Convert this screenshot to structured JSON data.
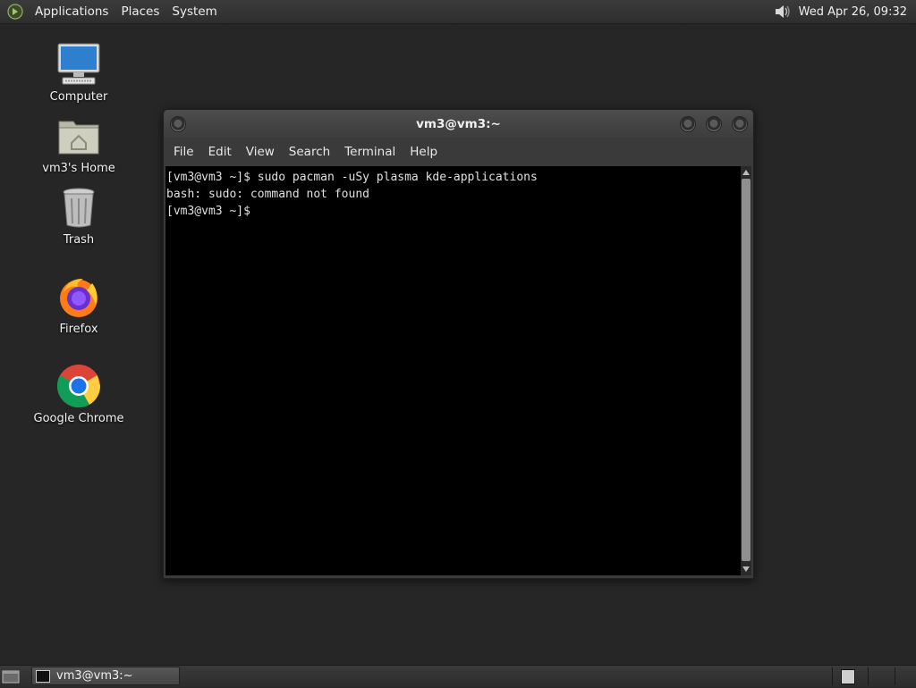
{
  "top_panel": {
    "menus": [
      "Applications",
      "Places",
      "System"
    ],
    "clock": "Wed Apr 26, 09:32"
  },
  "desktop": {
    "icons": [
      {
        "label": "Computer",
        "icon": "computer-icon"
      },
      {
        "label": "vm3's Home",
        "icon": "home-folder-icon"
      },
      {
        "label": "Trash",
        "icon": "trash-icon"
      },
      {
        "label": "Firefox",
        "icon": "firefox-icon"
      },
      {
        "label": "Google Chrome",
        "icon": "chrome-icon"
      }
    ]
  },
  "window": {
    "title": "vm3@vm3:~",
    "menu": [
      "File",
      "Edit",
      "View",
      "Search",
      "Terminal",
      "Help"
    ],
    "terminal_lines": [
      "[vm3@vm3 ~]$ sudo pacman -uSy plasma kde-applications",
      "bash: sudo: command not found",
      "[vm3@vm3 ~]$ "
    ]
  },
  "taskbar": {
    "task_label": "vm3@vm3:~"
  },
  "colors": {
    "desktop_bg": "#262626",
    "terminal_bg": "#000000",
    "terminal_fg": "#e0e0e0"
  }
}
